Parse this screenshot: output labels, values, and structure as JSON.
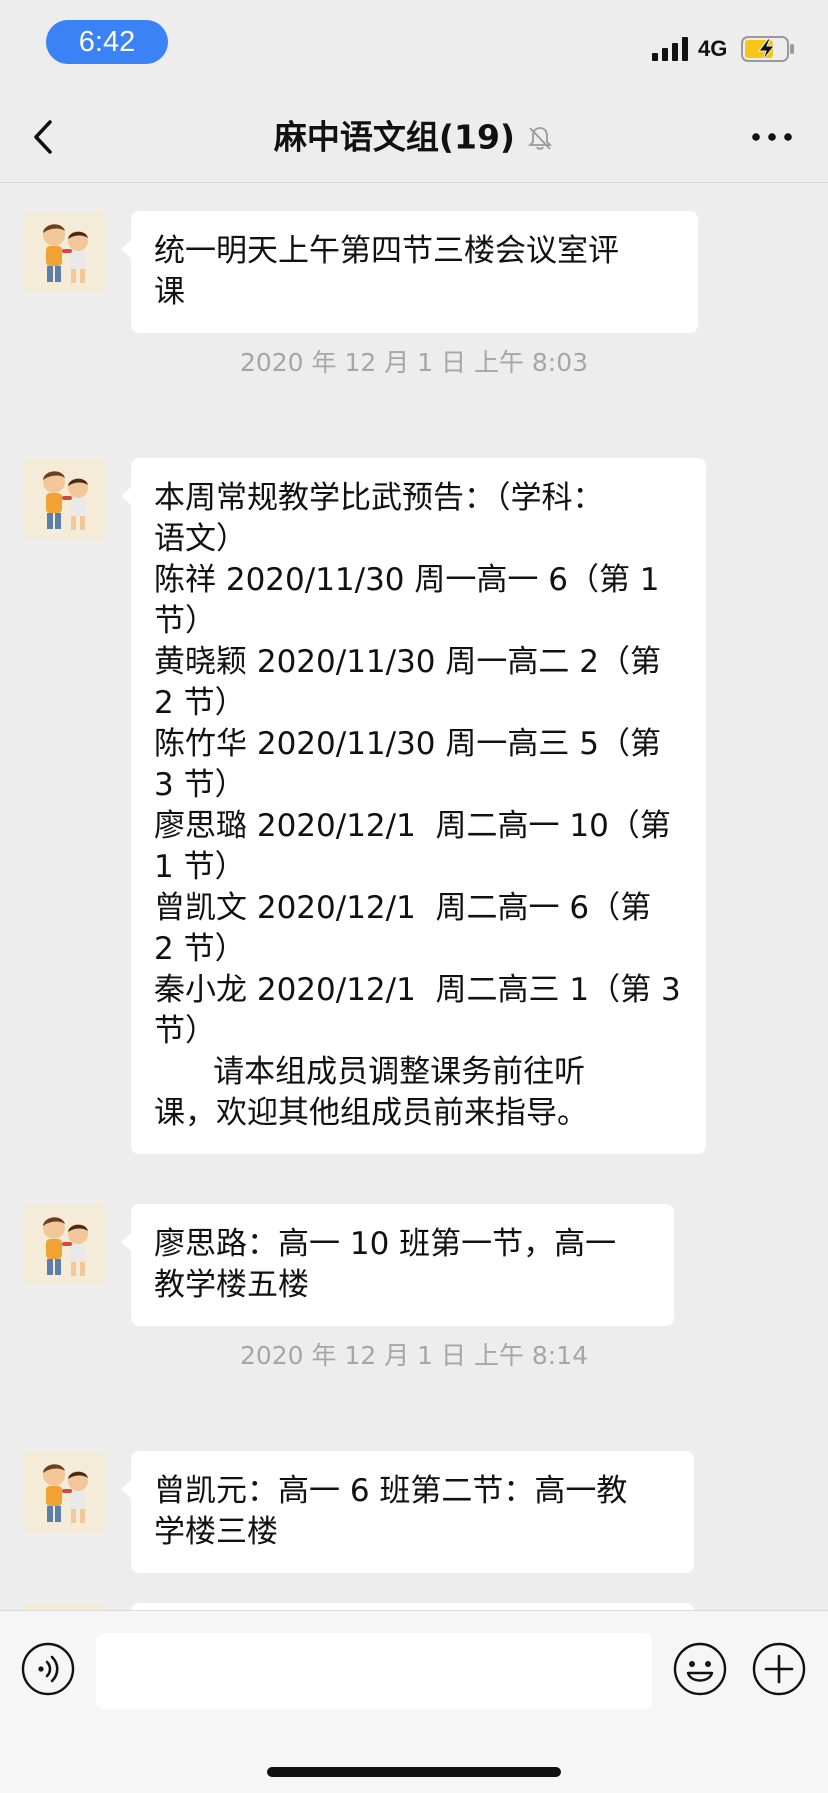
{
  "status_bar": {
    "time": "6:42",
    "network": "4G",
    "signal_icon": "signal-bars-icon",
    "battery_icon": "battery-charging-icon",
    "battery_color": "#f5c518"
  },
  "nav": {
    "back_icon": "chevron-left-icon",
    "title": "麻中语文组(19)",
    "mute_icon": "bell-muted-icon",
    "more_icon": "more-dots-icon"
  },
  "messages": [
    {
      "type": "message",
      "sender_avatar": "cartoon-kids-avatar",
      "text": "统一明天上午第四节三楼会议室评\n课"
    },
    {
      "type": "timestamp",
      "text": "2020 年 12 月 1 日 上午 8:03"
    },
    {
      "type": "message",
      "sender_avatar": "cartoon-kids-avatar",
      "text": "本周常规教学比武预告：（学科：\n语文）\n陈祥 2020/11/30 周一高一 6（第 1\n节）\n黄晓颖 2020/11/30 周一高二 2（第\n2 节）\n陈竹华 2020/11/30 周一高三 5（第\n3 节）\n廖思璐 2020/12/1  周二高一 10（第\n1 节）\n曾凯文 2020/12/1  周二高一 6（第\n2 节）\n秦小龙 2020/12/1  周二高三 1（第 3\n节）\n      请本组成员调整课务前往听\n课，欢迎其他组成员前来指导。"
    },
    {
      "type": "message",
      "sender_avatar": "cartoon-kids-avatar",
      "text": "廖思路：高一 10 班第一节，高一\n教学楼五楼"
    },
    {
      "type": "timestamp",
      "text": "2020 年 12 月 1 日 上午 8:14"
    },
    {
      "type": "message",
      "sender_avatar": "cartoon-kids-avatar",
      "text": "曾凯元：高一 6 班第二节：高一教\n学楼三楼"
    }
  ],
  "input_bar": {
    "voice_icon": "voice-icon",
    "input_value": "",
    "emoji_icon": "emoji-icon",
    "plus_icon": "plus-icon"
  },
  "colors": {
    "background": "#ededed",
    "bubble": "#ffffff",
    "time_pill": "#3a82f6",
    "timestamp_text": "#a6a6a6"
  }
}
